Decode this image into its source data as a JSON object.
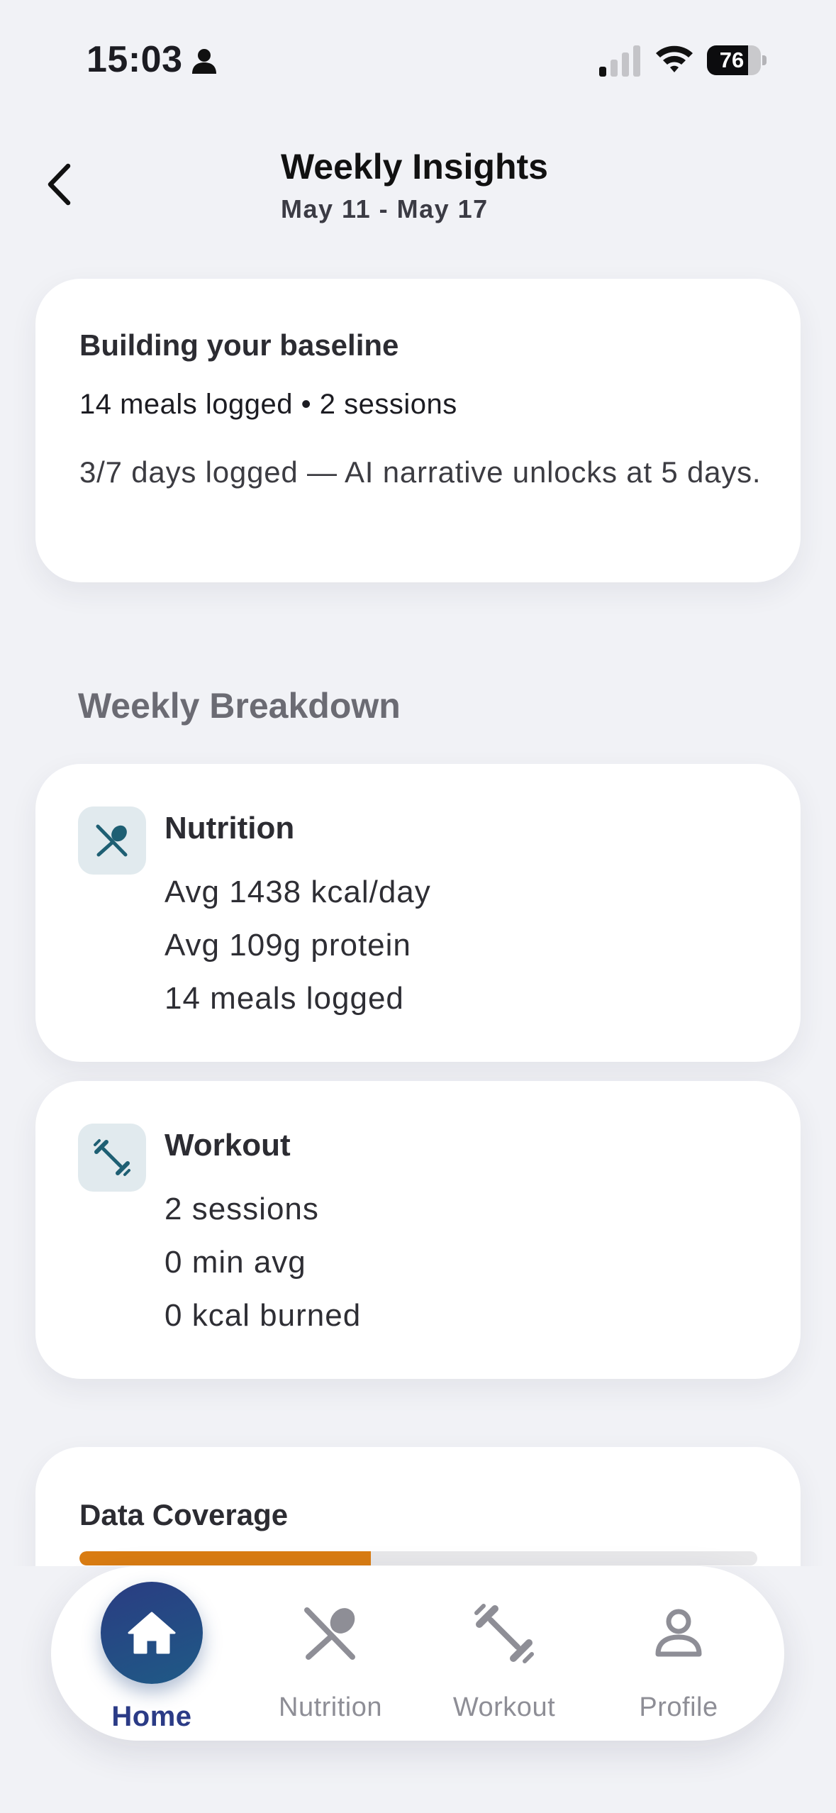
{
  "status_bar": {
    "time": "15:03",
    "battery": "76",
    "battery_level": 0.76
  },
  "header": {
    "title": "Weekly Insights",
    "subtitle": "May 11 - May 17"
  },
  "baseline": {
    "title": "Building your baseline",
    "summary": "14 meals logged • 2 sessions",
    "message": "3/7 days logged — AI narrative unlocks at 5 days."
  },
  "breakdown": {
    "section_title": "Weekly Breakdown",
    "nutrition": {
      "icon": "fork-spoon-icon",
      "title": "Nutrition",
      "lines": [
        "Avg 1438 kcal/day",
        "Avg 109g protein",
        "14 meals logged"
      ]
    },
    "workout": {
      "icon": "dumbbell-icon",
      "title": "Workout",
      "lines": [
        "2 sessions",
        "0 min avg",
        "0 kcal burned"
      ]
    }
  },
  "coverage": {
    "title": "Data Coverage",
    "fraction": 0.43
  },
  "tabbar": {
    "active": "Home",
    "items": [
      {
        "label": "Home",
        "icon": "home-icon"
      },
      {
        "label": "Nutrition",
        "icon": "fork-spoon-icon"
      },
      {
        "label": "Workout",
        "icon": "dumbbell-icon"
      },
      {
        "label": "Profile",
        "icon": "person-icon"
      }
    ]
  },
  "colors": {
    "background": "#f1f2f6",
    "accent": "#2b3b86",
    "progress": "#d97c12",
    "icon_teal": "#1e5f73",
    "tab_inactive": "#8e8e96"
  }
}
